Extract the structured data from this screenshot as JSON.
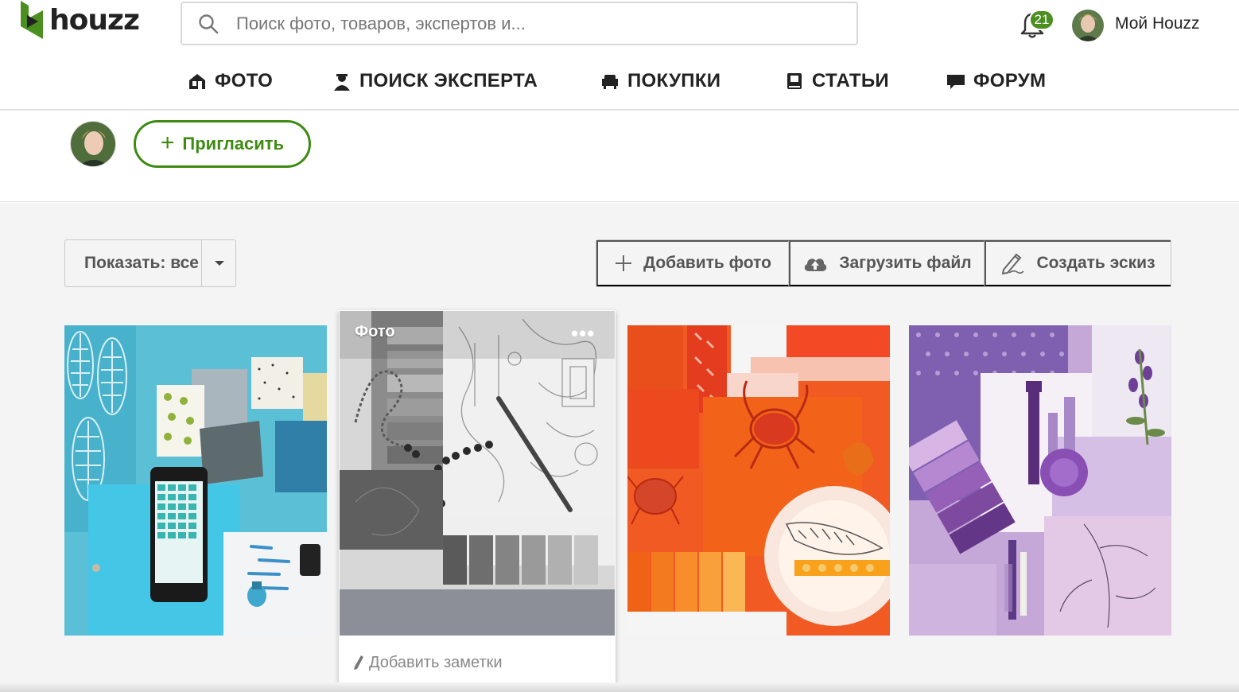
{
  "header": {
    "logo_text": "houzz",
    "search_placeholder": "Поиск фото, товаров, экспертов и...",
    "notifications_count": "21",
    "my_houzz_label": "Мой Houzz"
  },
  "nav": {
    "items": [
      {
        "label": "ФОТО",
        "icon": "house-icon"
      },
      {
        "label": "ПОИСК ЭКСПЕРТА",
        "icon": "expert-icon"
      },
      {
        "label": "ПОКУПКИ",
        "icon": "armchair-icon"
      },
      {
        "label": "СТАТЬИ",
        "icon": "book-icon"
      },
      {
        "label": "ФОРУМ",
        "icon": "chat-icon"
      }
    ]
  },
  "profile": {
    "invite_label": "Пригласить"
  },
  "toolbar": {
    "filter_label": "Показать: все",
    "add_photo_label": "Добавить фото",
    "upload_file_label": "Загрузить файл",
    "create_sketch_label": "Создать эскиз"
  },
  "cards": {
    "hovered_label": "Фото",
    "more_label": "•••",
    "add_notes_label": "Добавить заметки"
  },
  "colors": {
    "brand_green": "#4a8f1f",
    "invite_green": "#3e8a12",
    "background_gray": "#f4f4f4"
  }
}
